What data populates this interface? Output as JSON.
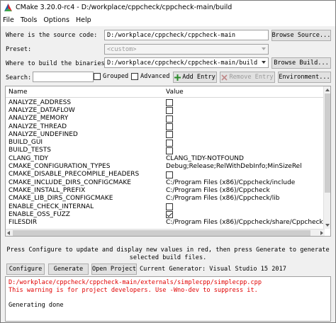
{
  "window": {
    "title": "CMake 3.20.0-rc4 - D:/workplace/cppcheck/cppcheck-main/build"
  },
  "menu": [
    "File",
    "Tools",
    "Options",
    "Help"
  ],
  "source": {
    "label": "Where is the source code:",
    "value": "D:/workplace/cppcheck/cppcheck-main",
    "browse": "Browse Source..."
  },
  "preset": {
    "label": "Preset:",
    "value": "<custom>"
  },
  "build": {
    "label": "Where to build the binaries:",
    "value": "D:/workplace/cppcheck/cppcheck-main/build",
    "browse": "Browse Build..."
  },
  "toolbar": {
    "search_label": "Search:",
    "search_value": "",
    "grouped": "Grouped",
    "advanced": "Advanced",
    "add_entry": "Add Entry",
    "remove_entry": "Remove Entry",
    "environment": "Environment..."
  },
  "table": {
    "headers": [
      "Name",
      "Value"
    ],
    "rows": [
      {
        "name": "ANALYZE_ADDRESS",
        "type": "bool",
        "checked": false
      },
      {
        "name": "ANALYZE_DATAFLOW",
        "type": "bool",
        "checked": false
      },
      {
        "name": "ANALYZE_MEMORY",
        "type": "bool",
        "checked": false
      },
      {
        "name": "ANALYZE_THREAD",
        "type": "bool",
        "checked": false
      },
      {
        "name": "ANALYZE_UNDEFINED",
        "type": "bool",
        "checked": false
      },
      {
        "name": "BUILD_GUI",
        "type": "bool",
        "checked": false
      },
      {
        "name": "BUILD_TESTS",
        "type": "bool",
        "checked": false
      },
      {
        "name": "CLANG_TIDY",
        "type": "text",
        "value": "CLANG_TIDY-NOTFOUND"
      },
      {
        "name": "CMAKE_CONFIGURATION_TYPES",
        "type": "text",
        "value": "Debug;Release;RelWithDebInfo;MinSizeRel"
      },
      {
        "name": "CMAKE_DISABLE_PRECOMPILE_HEADERS",
        "type": "bool",
        "checked": false
      },
      {
        "name": "CMAKE_INCLUDE_DIRS_CONFIGCMAKE",
        "type": "text",
        "value": "C:/Program Files (x86)/Cppcheck/include"
      },
      {
        "name": "CMAKE_INSTALL_PREFIX",
        "type": "text",
        "value": "C:/Program Files (x86)/Cppcheck"
      },
      {
        "name": "CMAKE_LIB_DIRS_CONFIGCMAKE",
        "type": "text",
        "value": "C:/Program Files (x86)/Cppcheck/lib"
      },
      {
        "name": "ENABLE_CHECK_INTERNAL",
        "type": "bool",
        "checked": false
      },
      {
        "name": "ENABLE_OSS_FUZZ",
        "type": "bool",
        "checked": true
      },
      {
        "name": "FILESDIR",
        "type": "text",
        "value": "C:/Program Files (x86)/Cppcheck/share/Cppcheck"
      }
    ]
  },
  "info": {
    "line1": "Press Configure to update and display new values in red, then press Generate to generate",
    "line2": "selected build files."
  },
  "buttons": {
    "configure": "Configure",
    "generate": "Generate",
    "open_project": "Open Project",
    "generator": "Current Generator: Visual Studio 15 2017"
  },
  "log": {
    "lines": [
      {
        "text": "   D:/workplace/cppcheck/cppcheck-main/externals/simplecpp/simplecpp.cpp",
        "color": "red"
      },
      {
        "text": "This warning is for project developers.  Use -Wno-dev to suppress it.",
        "color": "red"
      },
      {
        "text": "",
        "color": "black"
      },
      {
        "text": "Generating done",
        "color": "black"
      }
    ]
  },
  "colors": {
    "warning_text": "#e00000",
    "cmake_logo_red": "#e41f26",
    "cmake_logo_blue": "#1b5faa",
    "cmake_logo_green": "#3fa645"
  }
}
